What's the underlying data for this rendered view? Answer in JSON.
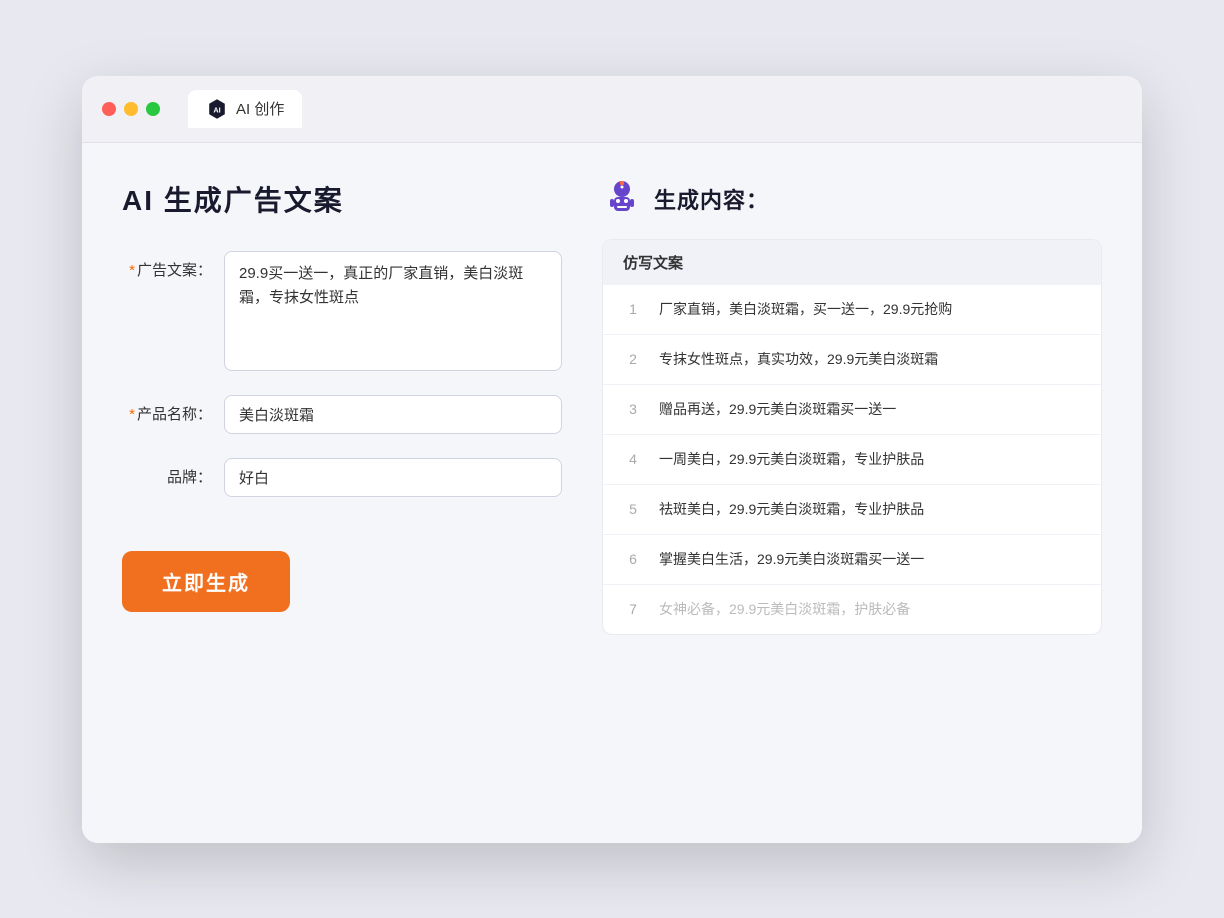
{
  "browser": {
    "tab_label": "AI 创作"
  },
  "page": {
    "title": "AI 生成广告文案"
  },
  "form": {
    "ad_copy_label": "广告文案：",
    "ad_copy_required": "*",
    "ad_copy_value": "29.9买一送一，真正的厂家直销，美白淡斑霜，专抹女性斑点",
    "product_name_label": "产品名称：",
    "product_name_required": "*",
    "product_name_value": "美白淡斑霜",
    "brand_label": "品牌：",
    "brand_value": "好白",
    "generate_button": "立即生成"
  },
  "results": {
    "header_icon": "robot",
    "header_title": "生成内容：",
    "table_column": "仿写文案",
    "items": [
      {
        "num": "1",
        "text": "厂家直销，美白淡斑霜，买一送一，29.9元抢购",
        "muted": false
      },
      {
        "num": "2",
        "text": "专抹女性斑点，真实功效，29.9元美白淡斑霜",
        "muted": false
      },
      {
        "num": "3",
        "text": "赠品再送，29.9元美白淡斑霜买一送一",
        "muted": false
      },
      {
        "num": "4",
        "text": "一周美白，29.9元美白淡斑霜，专业护肤品",
        "muted": false
      },
      {
        "num": "5",
        "text": "祛斑美白，29.9元美白淡斑霜，专业护肤品",
        "muted": false
      },
      {
        "num": "6",
        "text": "掌握美白生活，29.9元美白淡斑霜买一送一",
        "muted": false
      },
      {
        "num": "7",
        "text": "女神必备，29.9元美白淡斑霜，护肤必备",
        "muted": true
      }
    ]
  }
}
